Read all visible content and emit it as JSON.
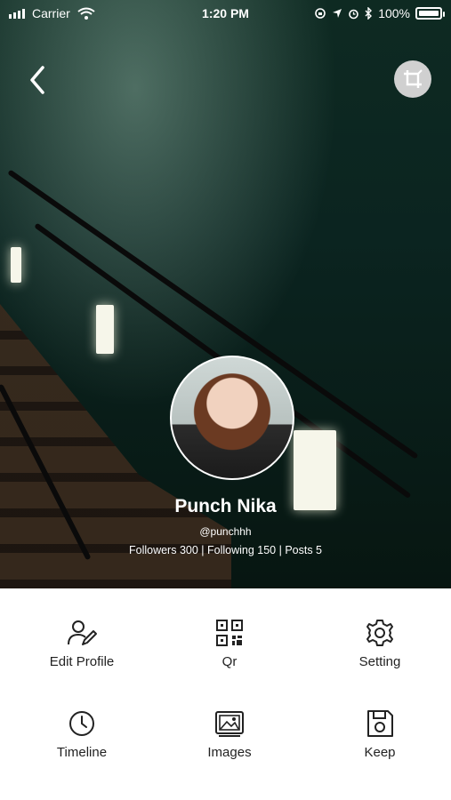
{
  "status_bar": {
    "carrier": "Carrier",
    "time": "1:20 PM",
    "battery": "100%"
  },
  "header": {
    "back_icon": "chevron-left-icon",
    "crop_icon": "crop-icon"
  },
  "profile": {
    "name": "Punch Nika",
    "handle": "@punchhh",
    "stats": "Followers 300 | Following 150 | Posts 5"
  },
  "menu": {
    "items": [
      {
        "label": "Edit Profile",
        "icon": "edit-profile-icon"
      },
      {
        "label": "Qr",
        "icon": "qr-code-icon"
      },
      {
        "label": "Setting",
        "icon": "gear-icon"
      },
      {
        "label": "Timeline",
        "icon": "clock-icon"
      },
      {
        "label": "Images",
        "icon": "images-icon"
      },
      {
        "label": "Keep",
        "icon": "floppy-disk-icon"
      }
    ]
  },
  "colors": {
    "overlay_text": "#ffffff",
    "menu_text": "#222222",
    "crop_button_bg": "#d0d0d0"
  }
}
